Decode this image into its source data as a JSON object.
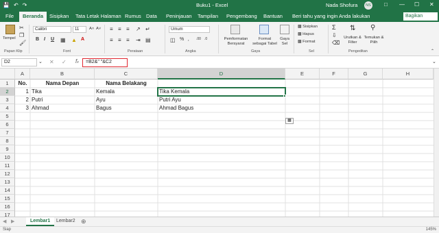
{
  "titlebar": {
    "title": "Buku1 - Excel",
    "user": "Nada Shofura",
    "avatar": "NS"
  },
  "tabs": [
    "File",
    "Beranda",
    "Sisipkan",
    "Tata Letak Halaman",
    "Rumus",
    "Data",
    "Peninjauan",
    "Tampilan",
    "Pengembang",
    "Bantuan"
  ],
  "tellme": "Beri tahu yang ingin Anda lakukan",
  "share": "Bagikan",
  "ribbon": {
    "groups": [
      "Papan Klip",
      "Font",
      "Perataan",
      "Angka",
      "Gaya",
      "Sel",
      "Pengeditan"
    ],
    "paste": "Tempel",
    "font_name": "Calibri",
    "font_size": "11",
    "number_format": "Umum",
    "conditional": "Pemformatan Bersyarat",
    "format_table": "Format sebagai Tabel",
    "cell_styles": "Gaya Sel",
    "insert": "Sisipkan",
    "delete": "Hapus",
    "format": "Format",
    "sort_filter": "Urutkan & Filter",
    "find_select": "Temukan & Pilih"
  },
  "formula_bar": {
    "name_box": "D2",
    "formula": "=B2&\" \"&C2"
  },
  "columns": [
    "A",
    "B",
    "C",
    "D",
    "F",
    "G",
    "H"
  ],
  "column_e": "E",
  "rows": [
    "1",
    "2",
    "3",
    "4",
    "5",
    "6",
    "7",
    "8",
    "9",
    "10",
    "11",
    "12",
    "13",
    "14",
    "15",
    "16",
    "17"
  ],
  "cells": {
    "A1": "No.",
    "B1": "Nama Depan",
    "C1": "Nama Belakang",
    "A2": "1",
    "B2": "Tika",
    "C2": "Kemala",
    "D2": "Tika Kemala",
    "A3": "2",
    "B3": "Putri",
    "C3": "Ayu",
    "D3": "Putri Ayu",
    "A4": "3",
    "B4": "Ahmad",
    "C4": "Bagus",
    "D4": "Ahmad Bagus"
  },
  "sheets": [
    "Lembar1",
    "Lembar2"
  ],
  "status": {
    "left": "Siap",
    "zoom": "145%"
  }
}
